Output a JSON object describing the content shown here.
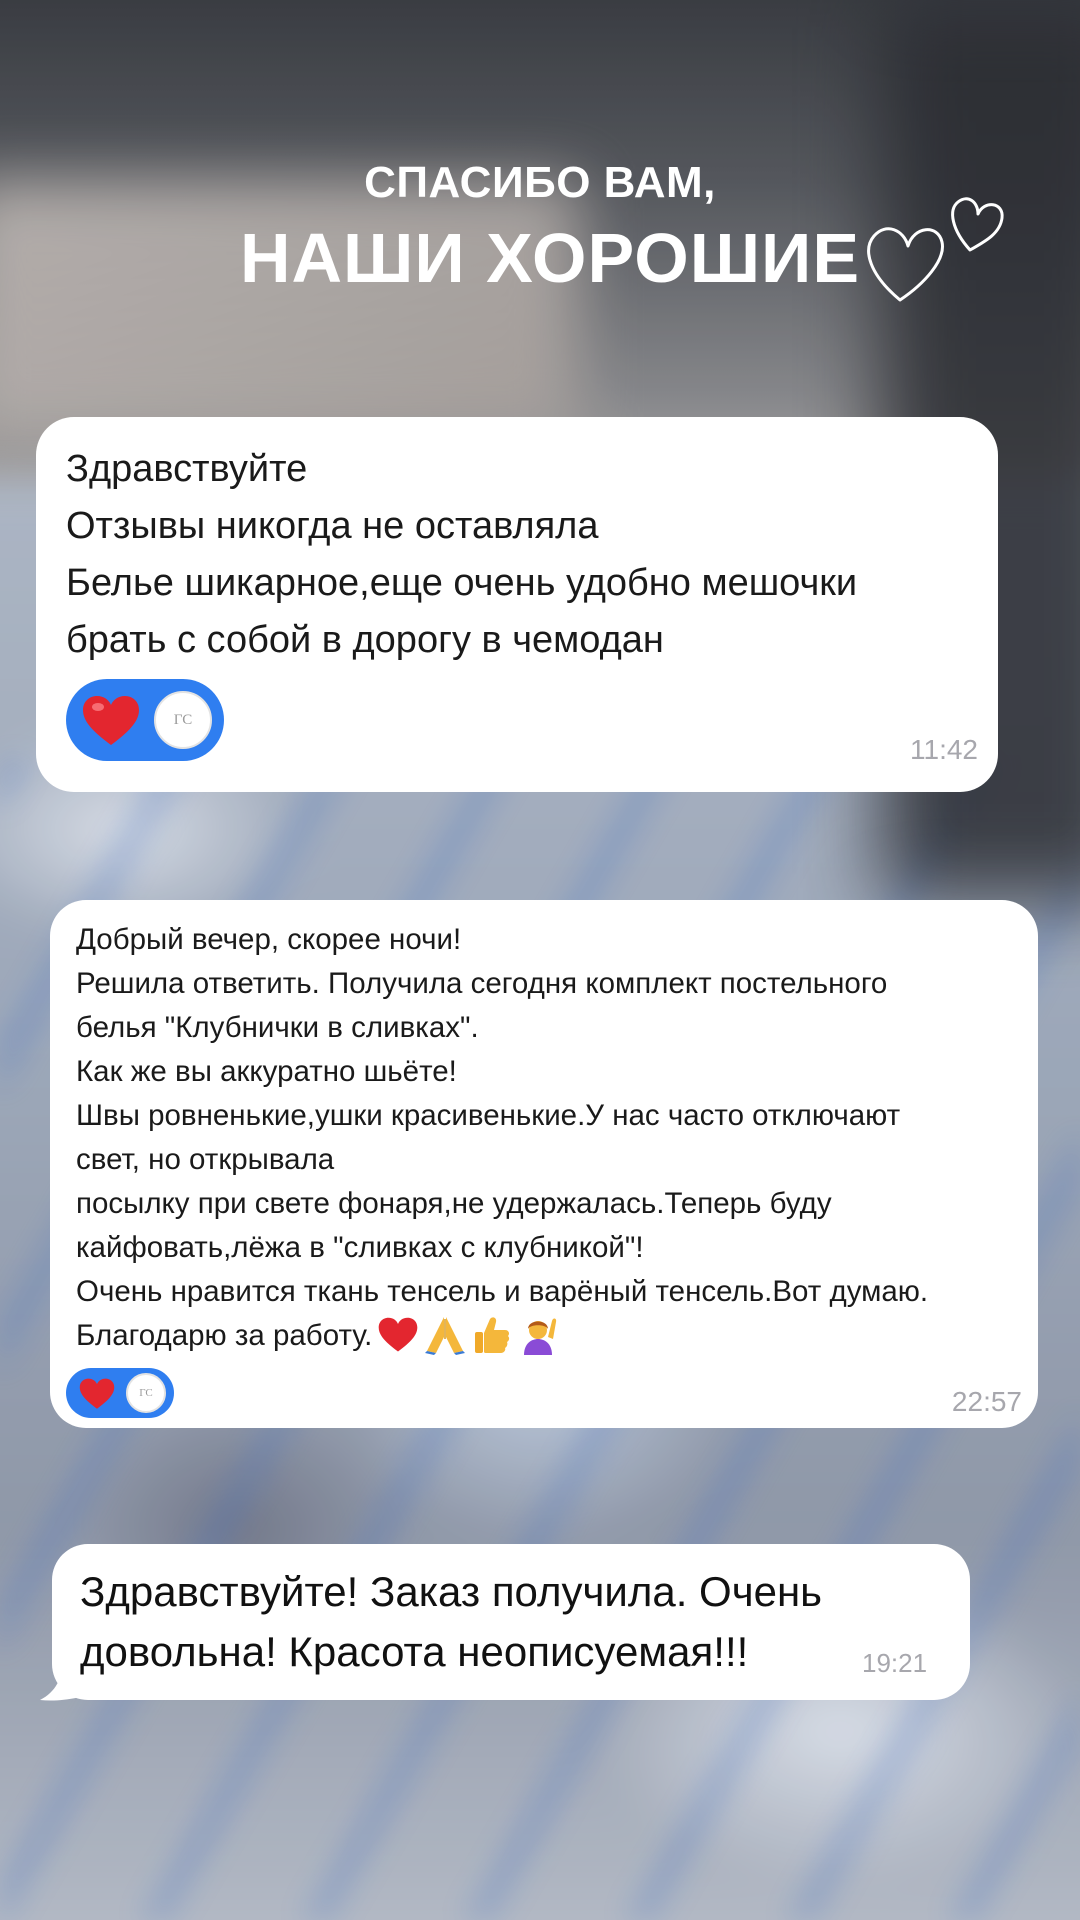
{
  "header": {
    "line1": "СПАСИБО ВАМ,",
    "line2": "НАШИ ХОРОШИЕ",
    "decoration_icon": "two-hearts-outline-icon"
  },
  "messages": [
    {
      "lines": [
        "Здравствуйте",
        "Отзывы никогда не оставляла",
        "Белье шикарное,еще очень удобно мешочки",
        "брать с собой в дорогу в чемодан"
      ],
      "time": "11:42",
      "reaction": {
        "emoji": "red-heart-icon",
        "avatar_text": "ГС"
      }
    },
    {
      "lines": [
        "Добрый вечер, скорее ночи!",
        "Решила ответить. Получила сегодня комплект постельного",
        "белья \"Клубнички в сливках\".",
        "Как же вы аккуратно шьёте!",
        "Швы ровненькие,ушки красивенькие.У нас часто отключают",
        "свет, но открывала",
        "посылку при  свете фонаря,не удержалась.Теперь буду",
        "кайфовать,лёжа в \"сливках с клубникой\"!",
        "Очень нравится ткань тенсель и варёный  тенсель.Вот думаю.",
        "Благодарю за работу."
      ],
      "trailing_emojis": [
        "red-heart-icon",
        "folded-hands-icon",
        "thumbs-up-icon",
        "woman-raising-hand-icon"
      ],
      "time": "22:57",
      "reaction": {
        "emoji": "red-heart-icon",
        "avatar_text": "ГС"
      }
    },
    {
      "lines": [
        "Здравствуйте! Заказ получила. Очень",
        "довольна! Красота неописуемая!!!"
      ],
      "time": "19:21"
    }
  ],
  "colors": {
    "reaction_blue": "#2f7ef0",
    "heart_red": "#e3262f",
    "time_gray": "#a7a7ad",
    "bubble_white": "#ffffff"
  }
}
